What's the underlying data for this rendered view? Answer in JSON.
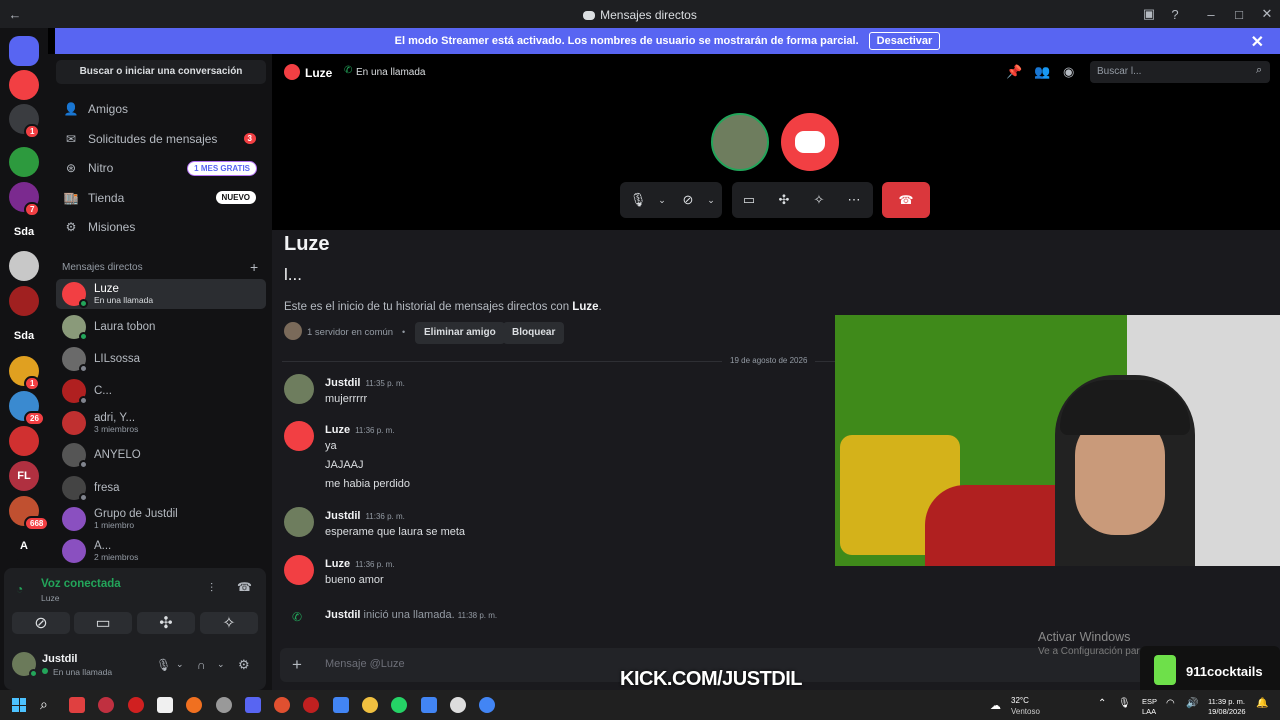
{
  "window": {
    "title": "Mensajes directos"
  },
  "banner": {
    "text": "El modo Streamer está activado. Los nombres de usuario se mostrarán de forma parcial.",
    "button": "Desactivar"
  },
  "guilds": [
    {
      "label": "",
      "color": "#5865f2",
      "badge": ""
    },
    {
      "label": "",
      "color": "#f23f43",
      "badge": ""
    },
    {
      "label": "",
      "color": "#3a3c40",
      "badge": "1"
    },
    {
      "label": "",
      "color": "#2d9a3e",
      "badge": ""
    },
    {
      "label": "",
      "color": "#7b2a8f",
      "badge": "7"
    },
    {
      "label": "Sda",
      "color": "#121214",
      "badge": ""
    },
    {
      "label": "",
      "color": "#c8c8c8",
      "badge": ""
    },
    {
      "label": "",
      "color": "#a02020",
      "badge": ""
    },
    {
      "label": "Sda",
      "color": "#121214",
      "badge": ""
    },
    {
      "label": "",
      "color": "#e0a020",
      "badge": "1"
    },
    {
      "label": "",
      "color": "#3a8ad0",
      "badge": "26"
    },
    {
      "label": "",
      "color": "#d03030",
      "badge": ""
    },
    {
      "label": "FL",
      "color": "#b03040",
      "badge": ""
    },
    {
      "label": "",
      "color": "#c05030",
      "badge": "668"
    },
    {
      "label": "A",
      "color": "#121214",
      "badge": ""
    }
  ],
  "sidebar": {
    "search": "Buscar o iniciar una conversación",
    "nav": [
      {
        "label": "Amigos",
        "icon": "friends-icon"
      },
      {
        "label": "Solicitudes de mensajes",
        "icon": "mail-icon",
        "count": "3"
      },
      {
        "label": "Nitro",
        "icon": "nitro-icon",
        "pill": "1 MES GRATIS"
      },
      {
        "label": "Tienda",
        "icon": "shop-icon",
        "pill": "NUEVO"
      },
      {
        "label": "Misiones",
        "icon": "quest-icon"
      }
    ],
    "dm_header": "Mensajes directos",
    "dm_add": "+",
    "dms": [
      {
        "name": "Luze",
        "sub": "En una llamada",
        "color": "#f23f43",
        "active": true,
        "status": "#23a55a"
      },
      {
        "name": "Laura tobon",
        "sub": "",
        "color": "#8a9a7a",
        "status": "#23a55a"
      },
      {
        "name": "LILsossa",
        "sub": "",
        "color": "#6a6a6a",
        "status": "#80848e"
      },
      {
        "name": "C...",
        "sub": "",
        "color": "#b02020",
        "status": "#80848e"
      },
      {
        "name": "adri, Y...",
        "sub": "3 miembros",
        "color": "#c03030",
        "status": ""
      },
      {
        "name": "ANYELO",
        "sub": "",
        "color": "#555",
        "status": "#80848e"
      },
      {
        "name": "fresa",
        "sub": "",
        "color": "#444",
        "status": "#80848e"
      },
      {
        "name": "Grupo de Justdil",
        "sub": "1 miembro",
        "color": "#8a50c0",
        "status": ""
      },
      {
        "name": "A...",
        "sub": "2 miembros",
        "color": "#8a50c0",
        "status": ""
      }
    ]
  },
  "voice": {
    "status": "Voz conectada",
    "channel": "Luze"
  },
  "user": {
    "name": "Justdil",
    "status": "En una llamada"
  },
  "header": {
    "name": "Luze",
    "status": "En una llamada",
    "search_placeholder": "Buscar l..."
  },
  "chat": {
    "title": "Luze",
    "subtitle": "l...",
    "intro_prefix": "Este es el inicio de tu historial de mensajes directos con ",
    "intro_name": "Luze",
    "intro_suffix": ".",
    "mutual": "1 servidor en común",
    "remove_friend": "Eliminar amigo",
    "block": "Bloquear",
    "date_divider": "19 de agosto de 2026",
    "messages": [
      {
        "author": "Justdil",
        "time": "11:35 p. m.",
        "lines": [
          "mujerrrrr"
        ]
      },
      {
        "author": "Luze",
        "time": "11:36 p. m.",
        "lines": [
          "ya",
          "JAJAAJ",
          "me habia perdido"
        ]
      },
      {
        "author": "Justdil",
        "time": "11:36 p. m.",
        "lines": [
          "esperame que laura se meta"
        ]
      },
      {
        "author": "Luze",
        "time": "11:36 p. m.",
        "lines": [
          "bueno amor"
        ]
      }
    ],
    "call_event": {
      "author": "Justdil",
      "text": "inició una llamada.",
      "time": "11:38 p. m."
    },
    "composer_placeholder": "Mensaje @Luze"
  },
  "overlays": {
    "activate_title": "Activar Windows",
    "activate_sub": "Ve a Configuración par",
    "kick": "KICK.COM/JUSTDIL",
    "sponsor": "911cocktails"
  },
  "taskbar": {
    "weather_temp": "32°C",
    "weather_desc": "Ventoso",
    "lang_top": "ESP",
    "lang_bottom": "LAA",
    "time": "11:39 p. m.",
    "date": "19/08/2026"
  }
}
